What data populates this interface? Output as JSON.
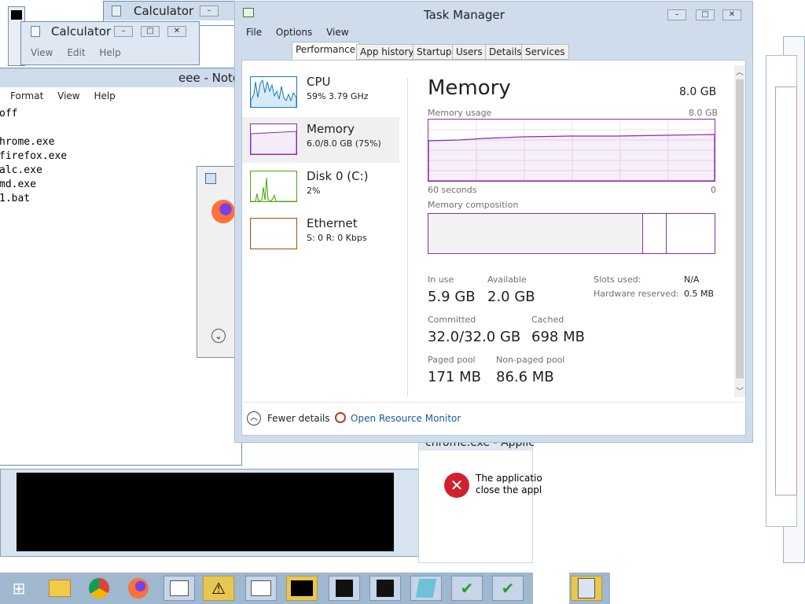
{
  "calc_back": {
    "title": "Calculator"
  },
  "calc_front": {
    "title": "Calculator",
    "menu": [
      "View",
      "Edit",
      "Help"
    ]
  },
  "notepad": {
    "title": "eee - Note",
    "menu": [
      "Format",
      "View",
      "Help"
    ],
    "lines": [
      "off",
      "",
      "hrome.exe",
      "firefox.exe",
      "alc.exe",
      "md.exe",
      "1.bat"
    ]
  },
  "taskmgr": {
    "title": "Task Manager",
    "menu": [
      "File",
      "Options",
      "View"
    ],
    "tabs": [
      "Performance",
      "App history",
      "Startup",
      "Users",
      "Details",
      "Services"
    ],
    "active_tab": "Performance",
    "sidebar": [
      {
        "name": "CPU",
        "value": "59% 3.79 GHz"
      },
      {
        "name": "Memory",
        "value": "6.0/8.0 GB (75%)"
      },
      {
        "name": "Disk 0 (C:)",
        "value": "2%"
      },
      {
        "name": "Ethernet",
        "value": "S: 0 R: 0 Kbps"
      }
    ],
    "heading": "Memory",
    "total": "8.0 GB",
    "usage_label": "Memory usage",
    "usage_max": "8.0 GB",
    "time_left": "60 seconds",
    "time_right": "0",
    "composition_label": "Memory composition",
    "stats": {
      "in_use_label": "In use",
      "in_use": "5.9 GB",
      "available_label": "Available",
      "available": "2.0 GB",
      "committed_label": "Committed",
      "committed": "32.0/32.0 GB",
      "cached_label": "Cached",
      "cached": "698 MB",
      "paged_label": "Paged pool",
      "paged": "171 MB",
      "nonpaged_label": "Non-paged pool",
      "nonpaged": "86.6 MB",
      "slots_label": "Slots used:",
      "slots": "N/A",
      "hwres_label": "Hardware reserved:",
      "hwres": "0.5 MB"
    },
    "fewer_details": "Fewer details",
    "open_monitor": "Open Resource Monitor"
  },
  "error_dialog": {
    "title_fragment": "chrome.exe - Applic",
    "line1": "The applicatio",
    "line2": "close the appl"
  },
  "colors": {
    "memory_accent": "#8b2dab",
    "cpu_accent": "#117dbb",
    "disk_accent": "#4da60c",
    "ethernet_accent": "#a74f01",
    "link": "#1a5a9a"
  }
}
